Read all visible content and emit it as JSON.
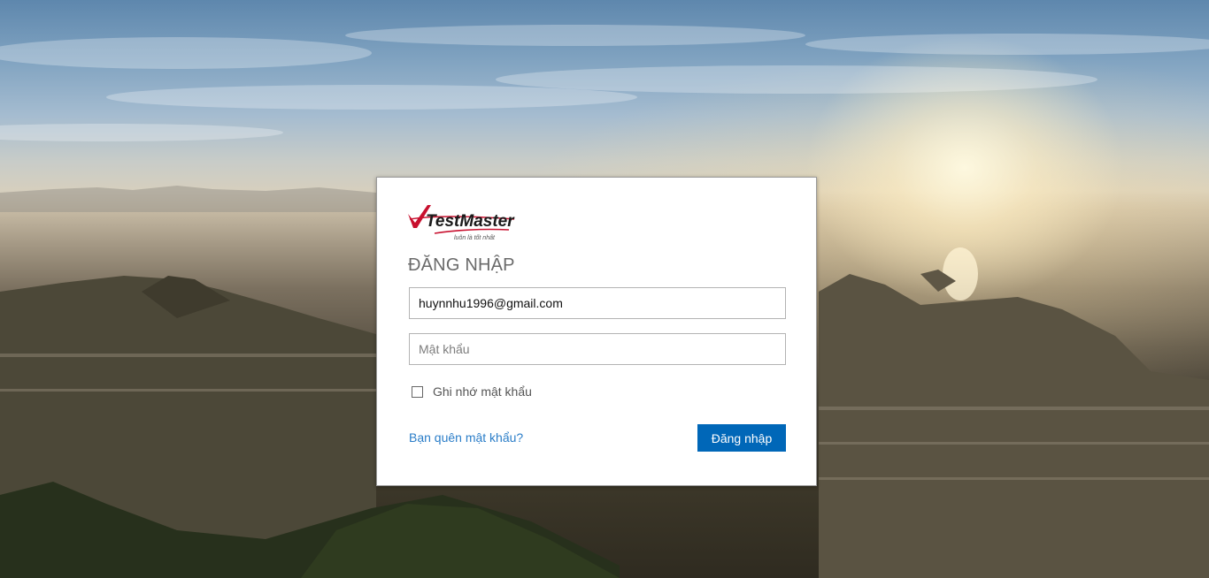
{
  "brand": {
    "name": "TestMaster",
    "tagline": "luôn là tốt nhất",
    "colors": {
      "red": "#c8102e",
      "dark": "#1a1a1a",
      "accent_blue": "#0067b8",
      "link_blue": "#2a7dc8"
    }
  },
  "login": {
    "title": "ĐĂNG NHẬP",
    "email_value": "huynnhu1996@gmail.com",
    "password_placeholder": "Mật khẩu",
    "remember_label": "Ghi nhớ mật khẩu",
    "remember_checked": false,
    "forgot_link": "Bạn quên mật khẩu?",
    "submit_label": "Đăng nhập"
  },
  "background": {
    "icon": "city-sunrise-photo"
  }
}
